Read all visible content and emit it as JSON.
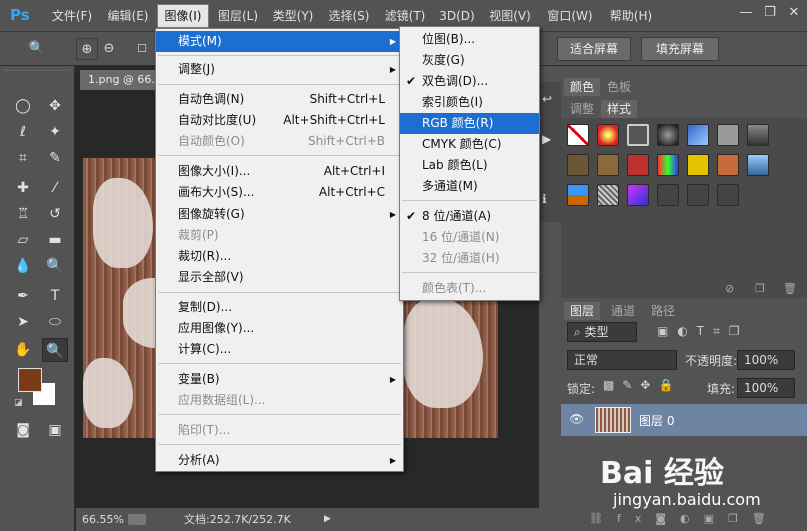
{
  "app": {
    "logo": "Ps"
  },
  "menubar": {
    "items": [
      "文件(F)",
      "编辑(E)",
      "图像(I)",
      "图层(L)",
      "类型(Y)",
      "选择(S)",
      "滤镜(T)",
      "3D(D)",
      "视图(V)",
      "窗口(W)",
      "帮助(H)"
    ],
    "active": "图像(I)"
  },
  "window": {
    "minimize": "—",
    "restore": "❐",
    "close": "✕"
  },
  "options": {
    "fit_screen": "适合屏幕",
    "fill_screen": "填充屏幕"
  },
  "document": {
    "tab_title": "1.png @ 66.6"
  },
  "status": {
    "zoom": "66.55%",
    "doc_info": "文档:252.7K/252.7K"
  },
  "image_menu": {
    "items": [
      {
        "label": "模式(M)",
        "shortcut": "",
        "submenu": true,
        "highlight": true,
        "disabled": false
      },
      {
        "label": "调整(J)",
        "shortcut": "",
        "submenu": true,
        "disabled": false
      },
      {
        "label": "自动色调(N)",
        "shortcut": "Shift+Ctrl+L",
        "disabled": false
      },
      {
        "label": "自动对比度(U)",
        "shortcut": "Alt+Shift+Ctrl+L",
        "disabled": false
      },
      {
        "label": "自动颜色(O)",
        "shortcut": "Shift+Ctrl+B",
        "disabled": true
      },
      {
        "label": "图像大小(I)...",
        "shortcut": "Alt+Ctrl+I",
        "disabled": false
      },
      {
        "label": "画布大小(S)...",
        "shortcut": "Alt+Ctrl+C",
        "disabled": false
      },
      {
        "label": "图像旋转(G)",
        "shortcut": "",
        "submenu": true,
        "disabled": false
      },
      {
        "label": "裁剪(P)",
        "shortcut": "",
        "disabled": true
      },
      {
        "label": "裁切(R)...",
        "shortcut": "",
        "disabled": false
      },
      {
        "label": "显示全部(V)",
        "shortcut": "",
        "disabled": false
      },
      {
        "label": "复制(D)...",
        "shortcut": "",
        "disabled": false
      },
      {
        "label": "应用图像(Y)...",
        "shortcut": "",
        "disabled": false
      },
      {
        "label": "计算(C)...",
        "shortcut": "",
        "disabled": false
      },
      {
        "label": "变量(B)",
        "shortcut": "",
        "submenu": true,
        "disabled": false
      },
      {
        "label": "应用数据组(L)...",
        "shortcut": "",
        "disabled": true
      },
      {
        "label": "陷印(T)...",
        "shortcut": "",
        "disabled": true
      },
      {
        "label": "分析(A)",
        "shortcut": "",
        "submenu": true,
        "disabled": false
      }
    ]
  },
  "mode_menu": {
    "items": [
      {
        "label": "位图(B)...",
        "checked": false,
        "disabled": false
      },
      {
        "label": "灰度(G)",
        "checked": false,
        "disabled": false
      },
      {
        "label": "双色调(D)...",
        "checked": true,
        "disabled": false
      },
      {
        "label": "索引颜色(I)",
        "checked": false,
        "disabled": false
      },
      {
        "label": "RGB 颜色(R)",
        "checked": false,
        "disabled": false,
        "highlight": true
      },
      {
        "label": "CMYK 颜色(C)",
        "checked": false,
        "disabled": false
      },
      {
        "label": "Lab 颜色(L)",
        "checked": false,
        "disabled": false
      },
      {
        "label": "多通道(M)",
        "checked": false,
        "disabled": false
      },
      {
        "label": "8 位/通道(A)",
        "checked": true,
        "disabled": false
      },
      {
        "label": "16 位/通道(N)",
        "checked": false,
        "disabled": true
      },
      {
        "label": "32 位/通道(H)",
        "checked": false,
        "disabled": true
      },
      {
        "label": "颜色表(T)...",
        "checked": false,
        "disabled": true
      }
    ]
  },
  "panels": {
    "color_tabs": [
      "颜色",
      "色板"
    ],
    "style_tabs": [
      "调整",
      "样式"
    ],
    "layer_tabs": [
      "图层",
      "通道",
      "路径"
    ],
    "kind_filter": "类型",
    "blend_mode": "正常",
    "opacity_label": "不透明度:",
    "opacity_value": "100%",
    "lock_label": "锁定:",
    "fill_label": "填充:",
    "fill_value": "100%",
    "layer_name": "图层 0"
  },
  "colors": {
    "foreground": "#7a3b17",
    "background": "#ffffff",
    "highlight": "#1c6fd1"
  },
  "watermark": {
    "brand": "Bai 经验",
    "url": "jingyan.baidu.com"
  }
}
